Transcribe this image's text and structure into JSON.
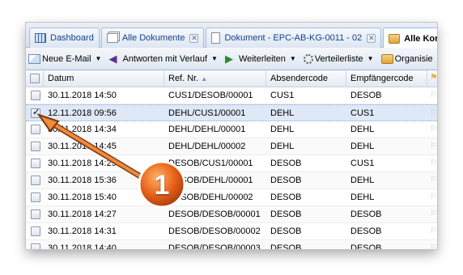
{
  "tabs": [
    {
      "label": "Dashboard",
      "icon": "dashboard-icon",
      "closable": false,
      "active": false
    },
    {
      "label": "Alle Dokumente",
      "icon": "documents-icon",
      "closable": true,
      "active": false
    },
    {
      "label": "Dokument - EPC-AB-KG-0011 - 02",
      "icon": "document-icon",
      "closable": true,
      "active": false
    },
    {
      "label": "Alle Korres",
      "icon": "folder-icon",
      "closable": false,
      "active": true
    }
  ],
  "tab_close_glyph": "✕",
  "toolbar": {
    "new_email": "Neue E-Mail",
    "reply_with_history": "Antworten mit Verlauf",
    "forward": "Weiterleiten",
    "distribution_list": "Verteilerliste",
    "organize": "Organisie"
  },
  "columns": {
    "date": "Datum",
    "ref": "Ref. Nr.",
    "sender_code": "Absendercode",
    "recipient_code": "Empfängercode"
  },
  "rows": [
    {
      "checked": false,
      "date": "30.11.2018 14:50",
      "ref": "CUS1/DESOB/00001",
      "sender": "CUS1",
      "recipient": "DESOB"
    },
    {
      "checked": true,
      "date": "12.11.2018 09:56",
      "ref": "DEHL/CUS1/00001",
      "sender": "DEHL",
      "recipient": "CUS1"
    },
    {
      "checked": false,
      "date": "30.11.2018 14:34",
      "ref": "DEHL/DEHL/00001",
      "sender": "DEHL",
      "recipient": "DEHL"
    },
    {
      "checked": false,
      "date": "30.11.2018 14:45",
      "ref": "DEHL/DEHL/00002",
      "sender": "DEHL",
      "recipient": "DEHL"
    },
    {
      "checked": false,
      "date": "30.11.2018 14:29",
      "ref": "DESOB/CUS1/00001",
      "sender": "DESOB",
      "recipient": "CUS1"
    },
    {
      "checked": false,
      "date": "30.11.2018 15:36",
      "ref": "DESOB/DEHL/00001",
      "sender": "DESOB",
      "recipient": "DEHL"
    },
    {
      "checked": false,
      "date": "30.11.2018 15:40",
      "ref": "DESOB/DEHL/00002",
      "sender": "DESOB",
      "recipient": "DEHL"
    },
    {
      "checked": false,
      "date": "30.11.2018 14:27",
      "ref": "DESOB/DESOB/00001",
      "sender": "DESOB",
      "recipient": "DESOB"
    },
    {
      "checked": false,
      "date": "30.11.2018 14:31",
      "ref": "DESOB/DESOB/00002",
      "sender": "DESOB",
      "recipient": "DESOB"
    },
    {
      "checked": false,
      "date": "30.11.2018 14:40",
      "ref": "DESOB/DESOB/00003",
      "sender": "DESOB",
      "recipient": "DESOB"
    }
  ],
  "callout": {
    "number": "1",
    "color": "#e8621a"
  }
}
